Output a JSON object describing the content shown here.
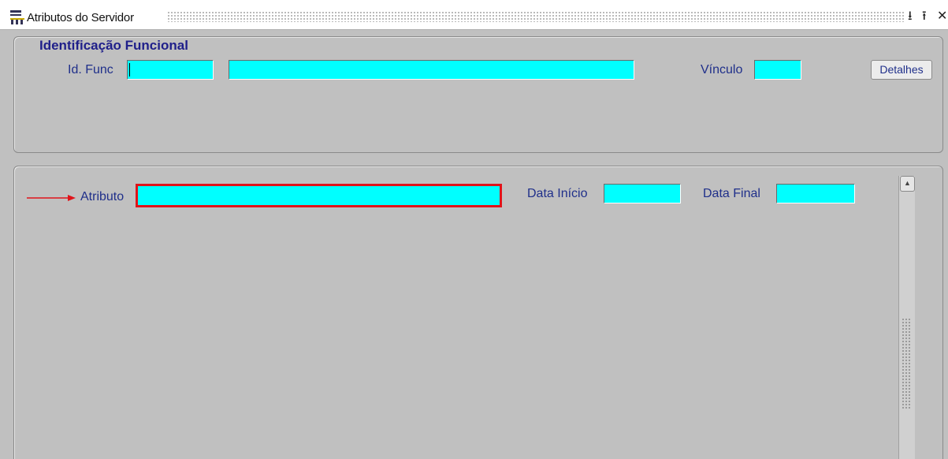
{
  "window": {
    "title": "Atributos do Servidor",
    "controls": {
      "minimize": "⭳",
      "maximize": "⭱",
      "close": "✕"
    }
  },
  "identificacao": {
    "caption": "Identificação Funcional",
    "id_func_label": "Id. Func",
    "id_func_value": "",
    "nome_value": "",
    "vinculo_label": "Vínculo",
    "vinculo_value": "",
    "detalhes_button": "Detalhes"
  },
  "atributos": {
    "atributo_label": "Atributo",
    "atributo_value": "",
    "data_inicio_label": "Data Início",
    "data_inicio_value": "",
    "data_final_label": "Data Final",
    "data_final_value": ""
  },
  "colors": {
    "field_bg": "#00ffff",
    "label": "#1f2f8a",
    "highlight": "#e0141a"
  }
}
